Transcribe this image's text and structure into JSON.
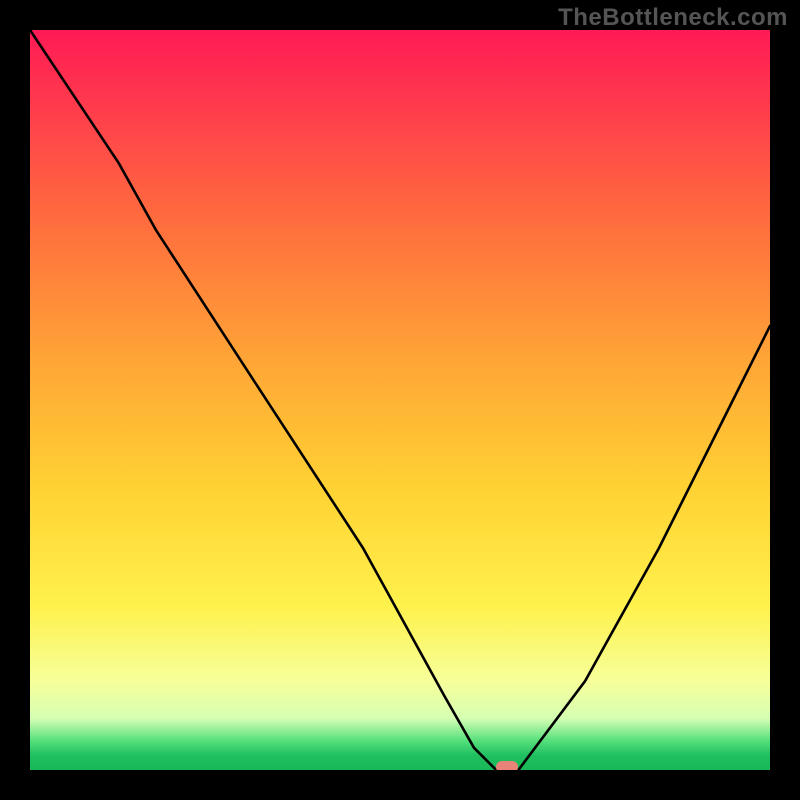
{
  "watermark": {
    "text": "TheBottleneck.com"
  },
  "chart_data": {
    "type": "line",
    "title": "",
    "xlabel": "",
    "ylabel": "",
    "xlim": [
      0,
      100
    ],
    "ylim": [
      0,
      100
    ],
    "grid": false,
    "series": [
      {
        "name": "bottleneck-curve",
        "x": [
          0,
          12,
          17,
          30,
          45,
          56,
          60,
          63,
          66,
          75,
          85,
          95,
          100
        ],
        "values": [
          100,
          82,
          73,
          53,
          30,
          10,
          3,
          0,
          0,
          12,
          30,
          50,
          60
        ]
      }
    ],
    "marker": {
      "x": 64.5,
      "y": 0,
      "color": "#e98378"
    },
    "background_gradient": {
      "stops": [
        {
          "pos": 0,
          "color": "#ff1a55"
        },
        {
          "pos": 25,
          "color": "#ff6a3e"
        },
        {
          "pos": 62,
          "color": "#ffd233"
        },
        {
          "pos": 88,
          "color": "#f6ff9a"
        },
        {
          "pos": 96,
          "color": "#58e07d"
        },
        {
          "pos": 100,
          "color": "#18b858"
        }
      ]
    }
  }
}
